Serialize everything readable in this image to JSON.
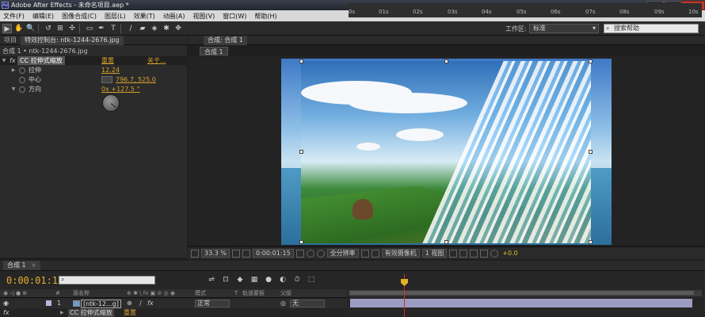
{
  "titlebar": {
    "app_icon": "Ae",
    "title": "Adobe After Effects - 未命名项目.aep *",
    "minimize": "–",
    "maximize": "□",
    "close": "✕"
  },
  "menu": [
    "文件(F)",
    "编辑(E)",
    "图像合成(C)",
    "图层(L)",
    "效果(T)",
    "动画(A)",
    "视图(V)",
    "窗口(W)",
    "帮助(H)"
  ],
  "toolbar": {
    "tools": [
      "▶",
      "✋",
      "🔍",
      "↺",
      "⊞",
      "✣",
      "▭",
      "✒",
      "T",
      "∕",
      "▰",
      "◈",
      "✱",
      "✥"
    ],
    "workspace_label": "工作区:",
    "workspace_value": "标准",
    "help_placeholder": "搜索帮助"
  },
  "left_panel": {
    "tabs": [
      "项目",
      "特效控制台: ntk-1244-2676.jpg"
    ],
    "header": "合成 1 • ntk-1244-2676.jpg",
    "effect": {
      "badge": "fx",
      "name": "CC 拉伸式缩放",
      "reset": "重置",
      "about": "关于..."
    },
    "params": [
      {
        "name": "拉伸",
        "value": "12.24"
      },
      {
        "name": "中心",
        "value": "796.7, 525.0"
      },
      {
        "name": "方向",
        "value": "0x +127.5 °"
      }
    ]
  },
  "comp_panel": {
    "tab": "合成: 合成 1",
    "subtab": "合成 1",
    "zoom": "33.3 %",
    "timecode": "0:00:01:15",
    "resolution": "全分辨率",
    "camera": "有效摄像机",
    "views": "1 视图",
    "exposure": "+0.0"
  },
  "timeline": {
    "tab": "合成 1",
    "tab_close": "×",
    "timecode": "0:00:01:15",
    "switches": [
      "⇌",
      "⊡",
      "◆",
      "▦",
      "●",
      "◐",
      "⏱",
      "⬚"
    ],
    "ruler_ticks": [
      "0s",
      "01s",
      "02s",
      "03s",
      "04s",
      "05s",
      "06s",
      "07s",
      "08s",
      "09s",
      "10s"
    ],
    "columns": {
      "av": "◉ ◁ ● ⊕",
      "num": "#",
      "source": "源名称",
      "switches": "⊕ ✱ \\ fx ▣ ⊘ ◎ ◉",
      "mode": "模式",
      "t": "T",
      "trkmat": "轨道蒙板",
      "parent": "父级"
    },
    "layer": {
      "num": "1",
      "name": "[ntk-12...g]",
      "mode": "正常",
      "parent": "无"
    },
    "effect_row": {
      "badge": "fx",
      "name": "CC 拉伸式缩放",
      "reset": "重置"
    }
  }
}
